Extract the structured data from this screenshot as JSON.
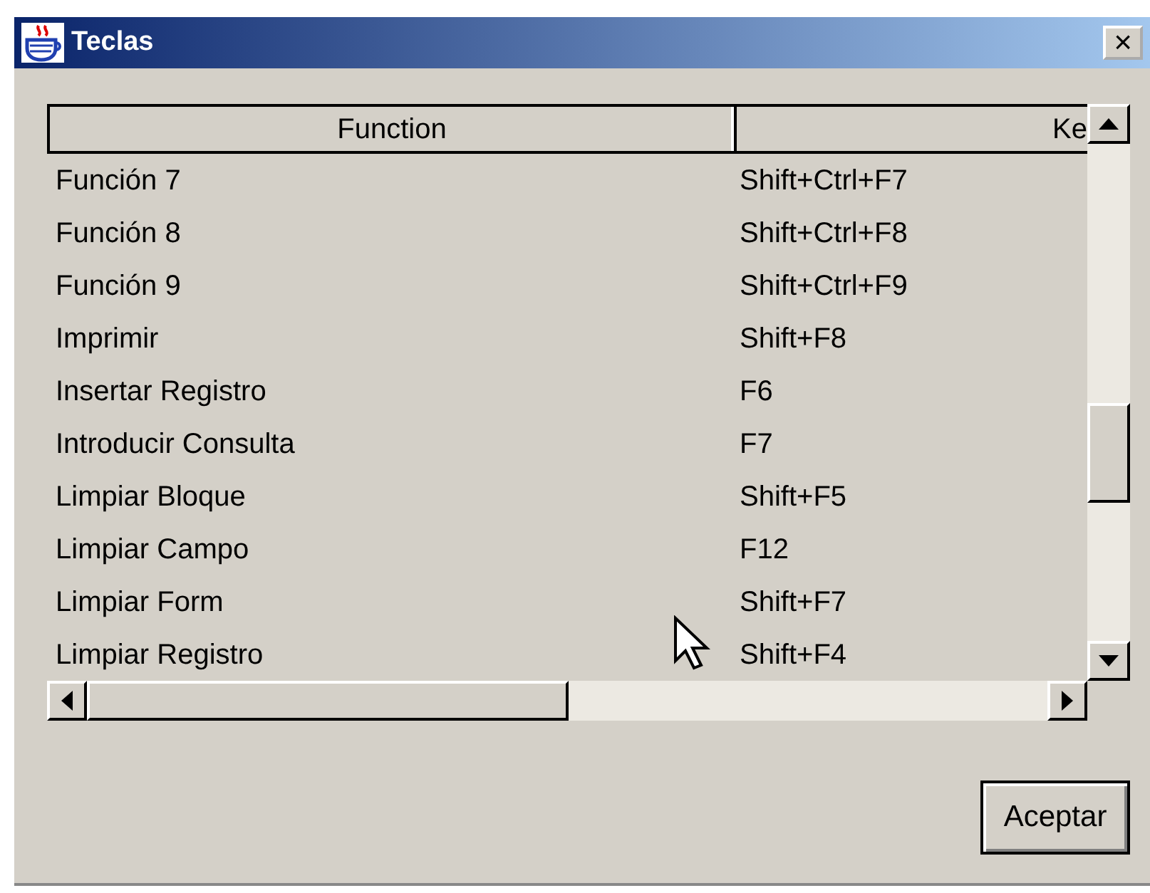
{
  "window": {
    "title": "Teclas",
    "close": "×"
  },
  "table": {
    "columns": [
      "Function",
      "Ke"
    ],
    "rows": [
      {
        "function": "Función 7",
        "key": "Shift+Ctrl+F7"
      },
      {
        "function": "Función 8",
        "key": "Shift+Ctrl+F8"
      },
      {
        "function": "Función 9",
        "key": "Shift+Ctrl+F9"
      },
      {
        "function": "Imprimir",
        "key": "Shift+F8"
      },
      {
        "function": "Insertar Registro",
        "key": "F6"
      },
      {
        "function": "Introducir Consulta",
        "key": "F7"
      },
      {
        "function": "Limpiar Bloque",
        "key": "Shift+F5"
      },
      {
        "function": "Limpiar Campo",
        "key": "F12"
      },
      {
        "function": "Limpiar Form",
        "key": "Shift+F7"
      },
      {
        "function": "Limpiar Registro",
        "key": "Shift+F4"
      }
    ]
  },
  "buttons": [
    "Aceptar"
  ]
}
